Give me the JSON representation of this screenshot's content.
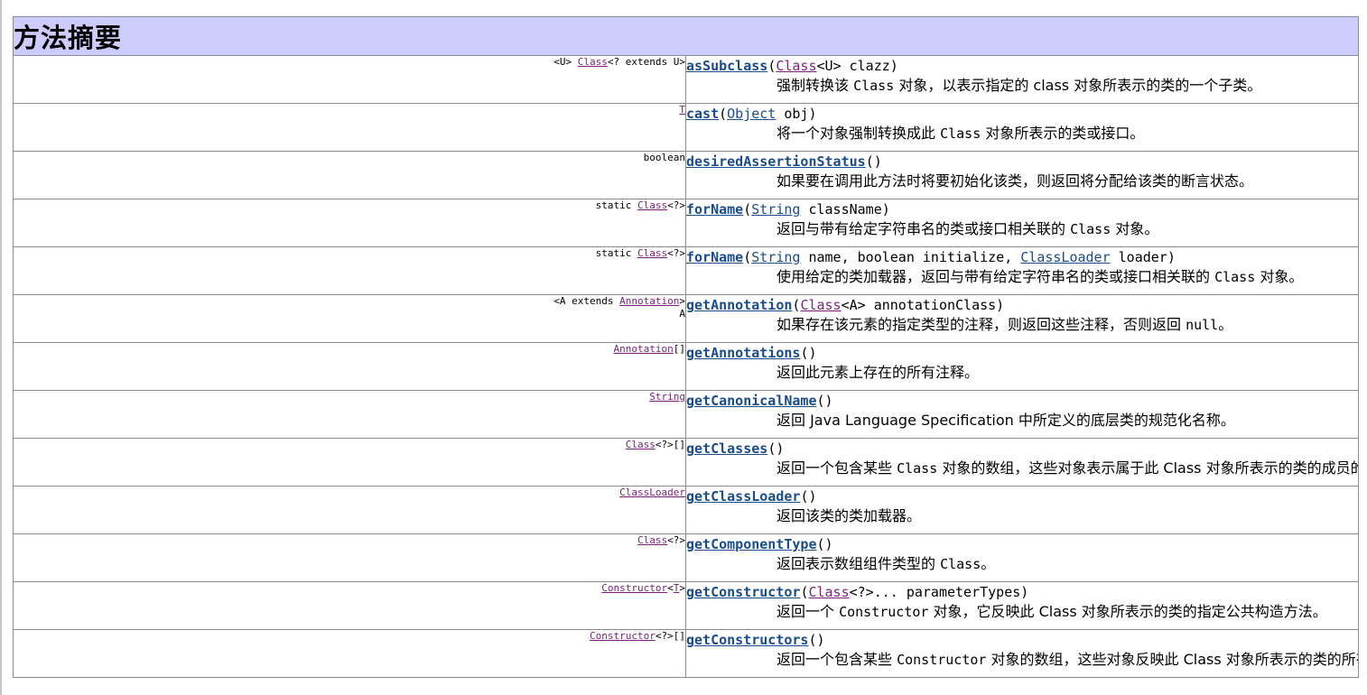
{
  "section_title": "方法摘要",
  "methods": [
    {
      "type_pre": "<U> ",
      "type_link": "Class",
      "type_post": "<? extends U>",
      "name": "asSubclass",
      "param_open": "(",
      "param_link": "Class",
      "param_rest": "<U> clazz)",
      "desc_a": "强制转换该 ",
      "desc_code": "Class",
      "desc_b": " 对象，以表示指定的 class 对象所表示的类的一个子类。"
    },
    {
      "type_pre": "",
      "type_link": "T",
      "type_post": "",
      "name": "cast",
      "param_open": "(",
      "param_link": "Object",
      "param_rest": " obj)",
      "desc_a": "将一个对象强制转换成此 ",
      "desc_code": "Class",
      "desc_b": " 对象所表示的类或接口。"
    },
    {
      "type_pre": "boolean",
      "type_link": "",
      "type_post": "",
      "name": "desiredAssertionStatus",
      "param_open": "()",
      "param_link": "",
      "param_rest": "",
      "desc_a": "如果要在调用此方法时将要初始化该类，则返回将分配给该类的断言状态。",
      "desc_code": "",
      "desc_b": ""
    },
    {
      "type_pre": "static ",
      "type_link": "Class",
      "type_post": "<?>",
      "name": "forName",
      "param_open": "(",
      "param_link": "String",
      "param_rest": " className)",
      "desc_a": "返回与带有给定字符串名的类或接口相关联的 ",
      "desc_code": "Class",
      "desc_b": " 对象。"
    },
    {
      "type_pre": "static ",
      "type_link": "Class",
      "type_post": "<?>",
      "name": "forName",
      "param_open": "(",
      "param_link": "String",
      "param_rest": " name, boolean initialize, ",
      "param_link2": "ClassLoader",
      "param_rest2": " loader)",
      "desc_a": "使用给定的类加载器，返回与带有给定字符串名的类或接口相关联的 ",
      "desc_code": "Class",
      "desc_b": " 对象。"
    },
    {
      "type_pre": "<A extends ",
      "type_link": "Annotation",
      "type_post": ">",
      "type_line2": "A",
      "name": "getAnnotation",
      "param_open": "(",
      "param_link": "Class",
      "param_rest": "<A> annotationClass)",
      "desc_a": "如果存在该元素的指定类型的注释，则返回这些注释，否则返回 ",
      "desc_code": "null",
      "desc_b": "。"
    },
    {
      "type_pre": "",
      "type_link": "Annotation",
      "type_post": "[]",
      "name": "getAnnotations",
      "param_open": "()",
      "param_link": "",
      "param_rest": "",
      "desc_a": "返回此元素上存在的所有注释。",
      "desc_code": "",
      "desc_b": ""
    },
    {
      "type_pre": "",
      "type_link": "String",
      "type_post": "",
      "name": "getCanonicalName",
      "param_open": "()",
      "param_link": "",
      "param_rest": "",
      "desc_a": "返回 Java Language Specification 中所定义的底层类的规范化名称。",
      "desc_code": "",
      "desc_b": ""
    },
    {
      "type_pre": "",
      "type_link": "Class",
      "type_post": "<?>[]",
      "name": "getClasses",
      "param_open": "()",
      "param_link": "",
      "param_rest": "",
      "desc_a": "返回一个包含某些 ",
      "desc_code": "Class",
      "desc_b": " 对象的数组，这些对象表示属于此 Class 对象所表示的类的成员的所有公共类和接口。"
    },
    {
      "type_pre": "",
      "type_link": "ClassLoader",
      "type_post": "",
      "name": "getClassLoader",
      "param_open": "()",
      "param_link": "",
      "param_rest": "",
      "desc_a": "返回该类的类加载器。",
      "desc_code": "",
      "desc_b": ""
    },
    {
      "type_pre": "",
      "type_link": "Class",
      "type_post": "<?>",
      "name": "getComponentType",
      "param_open": "()",
      "param_link": "",
      "param_rest": "",
      "desc_a": "返回表示数组组件类型的 ",
      "desc_code": "Class",
      "desc_b": "。"
    },
    {
      "type_pre": "",
      "type_link": "Constructor",
      "type_post": "<",
      "type_link2": "T",
      "type_post2": ">",
      "name": "getConstructor",
      "param_open": "(",
      "param_link": "Class",
      "param_rest": "<?>... parameterTypes)",
      "desc_a": "返回一个 ",
      "desc_code": "Constructor",
      "desc_b": " 对象，它反映此 Class 对象所表示的类的指定公共构造方法。"
    },
    {
      "type_pre": "",
      "type_link": "Constructor",
      "type_post": "<?>[]",
      "name": "getConstructors",
      "param_open": "()",
      "param_link": "",
      "param_rest": "",
      "desc_a": "返回一个包含某些 ",
      "desc_code": "Constructor",
      "desc_b": " 对象的数组，这些对象反映此 Class 对象所表示的类的所有公共构造方法。"
    }
  ]
}
